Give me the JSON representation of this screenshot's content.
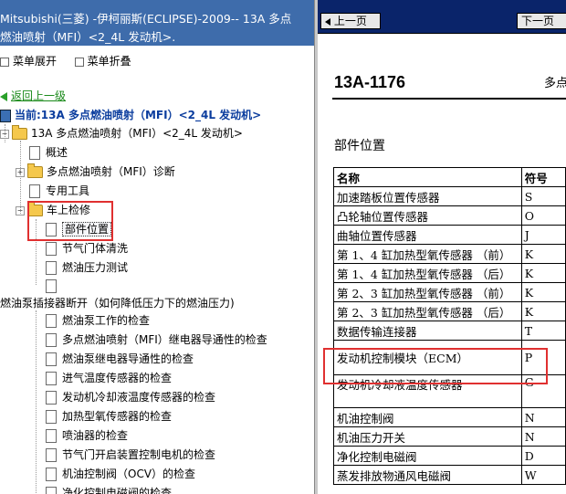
{
  "left_header": {
    "line1": "Mitsubishi(三菱) -伊柯丽斯(ECLIPSE)-2009-- 13A 多点",
    "line2": "燃油喷射（MFI）<2_4L 发动机>."
  },
  "menu": {
    "expand": "菜单展开",
    "collapse": "菜单折叠"
  },
  "back_link": "返回上一级",
  "current": "当前:13A 多点燃油喷射（MFI）<2_4L 发动机>",
  "tree": {
    "root": "13A 多点燃油喷射（MFI）<2_4L 发动机>",
    "overview": "概述",
    "diagnosis": "多点燃油喷射（MFI）诊断",
    "special_tools": "专用工具",
    "on_vehicle": "车上检修",
    "component_location": "部件位置",
    "throttle_clean": "节气门体清洗",
    "fuel_pressure_test": "燃油压力测试",
    "pump_connector": "燃油泵插接器断开（如何降低压力下的燃油压力)",
    "items": [
      "燃油泵工作的检查",
      "多点燃油喷射（MFI）继电器导通性的检查",
      "燃油泵继电器导通性的检查",
      "进气温度传感器的检查",
      "发动机冷却液温度传感器的检查",
      "加热型氧传感器的检查",
      "喷油器的检查",
      "节气门开启装置控制电机的检查",
      "机油控制阀（OCV）的检查",
      "净化控制电磁阀的检查"
    ]
  },
  "nav": {
    "prev": "上一页",
    "next": "下一页"
  },
  "doc": {
    "page_no": "13A-1176",
    "section_head": "多点",
    "title": "部件位置",
    "col_name": "名称",
    "col_symbol": "符号",
    "rows": [
      {
        "name": "加速踏板位置传感器",
        "symbol": "S"
      },
      {
        "name": "凸轮轴位置传感器",
        "symbol": "O"
      },
      {
        "name": "曲轴位置传感器",
        "symbol": "J"
      },
      {
        "name": "第 1、4 缸加热型氧传感器 （前）",
        "symbol": "K"
      },
      {
        "name": "第 1、4 缸加热型氧传感器 （后）",
        "symbol": "K"
      },
      {
        "name": "第 2、3 缸加热型氧传感器 （前）",
        "symbol": "K"
      },
      {
        "name": "第 2、3 缸加热型氧传感器 （后）",
        "symbol": "K"
      },
      {
        "name": "数据传输连接器",
        "symbol": "T"
      },
      {
        "name": "发动机控制模块（ECM）",
        "symbol": "P"
      },
      {
        "name": "发动机冷却液温度传感器",
        "symbol": "G"
      },
      {
        "name": "机油控制阀",
        "symbol": "N"
      },
      {
        "name": "机油压力开关",
        "symbol": "N"
      },
      {
        "name": "净化控制电磁阀",
        "symbol": "D"
      },
      {
        "name": "蒸发排放物通风电磁阀",
        "symbol": "W"
      }
    ]
  }
}
